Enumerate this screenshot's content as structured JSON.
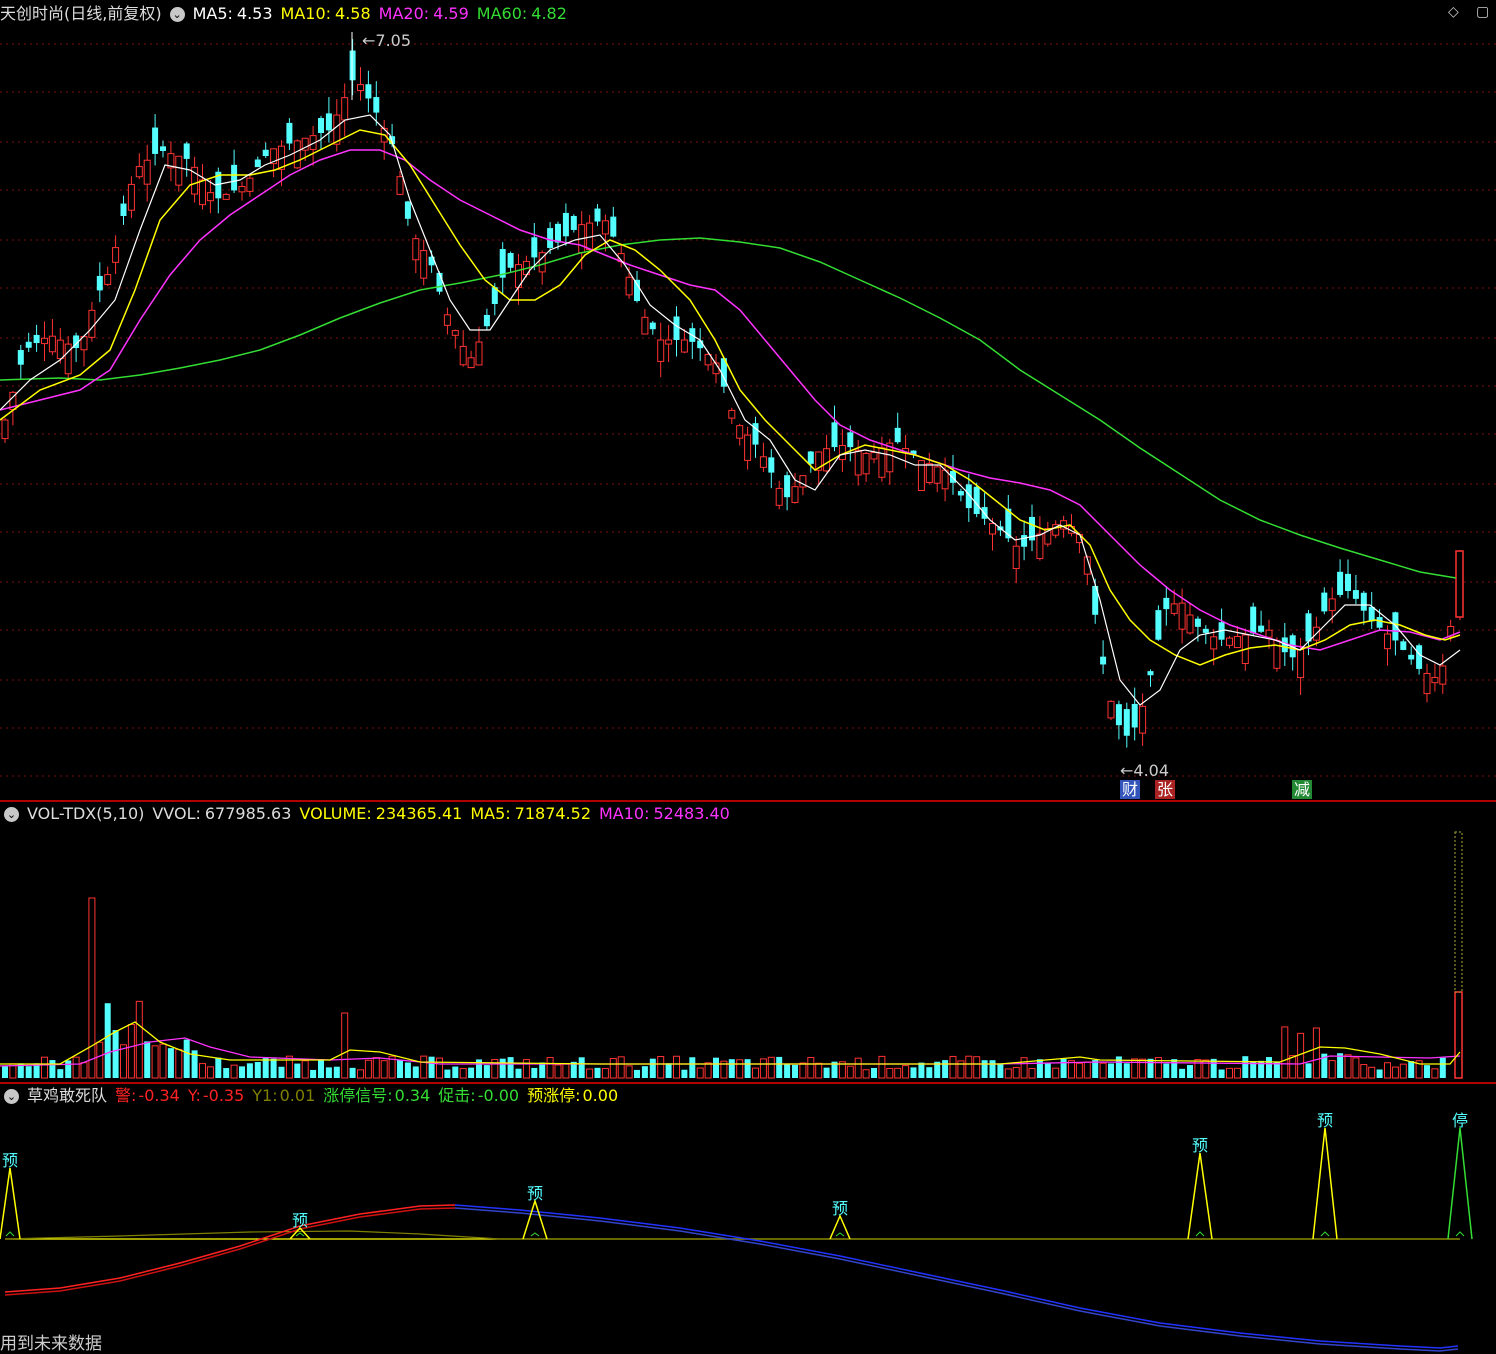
{
  "main": {
    "title": "天创时尚(日线,前复权)",
    "ma": [
      {
        "label": "MA5:",
        "value": "4.53",
        "color": "#ffffff"
      },
      {
        "label": "MA10:",
        "value": "4.58",
        "color": "#ffff00"
      },
      {
        "label": "MA20:",
        "value": "4.59",
        "color": "#ff33ff"
      },
      {
        "label": "MA60:",
        "value": "4.82",
        "color": "#33dd33"
      }
    ],
    "high_label": "7.05",
    "low_label": "4.04",
    "badges": [
      {
        "text": "财",
        "bg": "#3355bb"
      },
      {
        "text": "张",
        "bg": "#aa2222"
      },
      {
        "text": "减",
        "bg": "#228833"
      }
    ]
  },
  "vol": {
    "title": "VOL-TDX(5,10)",
    "items": [
      {
        "label": "VVOL:",
        "value": "677985.63",
        "color": "#dddddd"
      },
      {
        "label": "VOLUME:",
        "value": "234365.41",
        "color": "#ffff00"
      },
      {
        "label": "MA5:",
        "value": "71874.52",
        "color": "#ffff00"
      },
      {
        "label": "MA10:",
        "value": "52483.40",
        "color": "#ff33ff"
      }
    ]
  },
  "ind": {
    "title": "草鸡敢死队",
    "items": [
      {
        "label": "警:",
        "value": "-0.34",
        "color": "#ff2222"
      },
      {
        "label": "Y:",
        "value": "-0.35",
        "color": "#ff2222"
      },
      {
        "label": "Y1:",
        "value": "0.01",
        "color": "#808000"
      },
      {
        "label": "涨停信号:",
        "value": "0.34",
        "color": "#33dd33"
      },
      {
        "label": "促击:",
        "value": "-0.00",
        "color": "#33dd33"
      },
      {
        "label": "预涨停:",
        "value": "0.00",
        "color": "#ffff00"
      }
    ],
    "markers": [
      "预",
      "预",
      "预",
      "预",
      "预",
      "预",
      "停"
    ]
  },
  "footer": "用到未来数据",
  "icons": [
    "collapse-circle-icon",
    "diamond-icon",
    "square-icon"
  ]
}
